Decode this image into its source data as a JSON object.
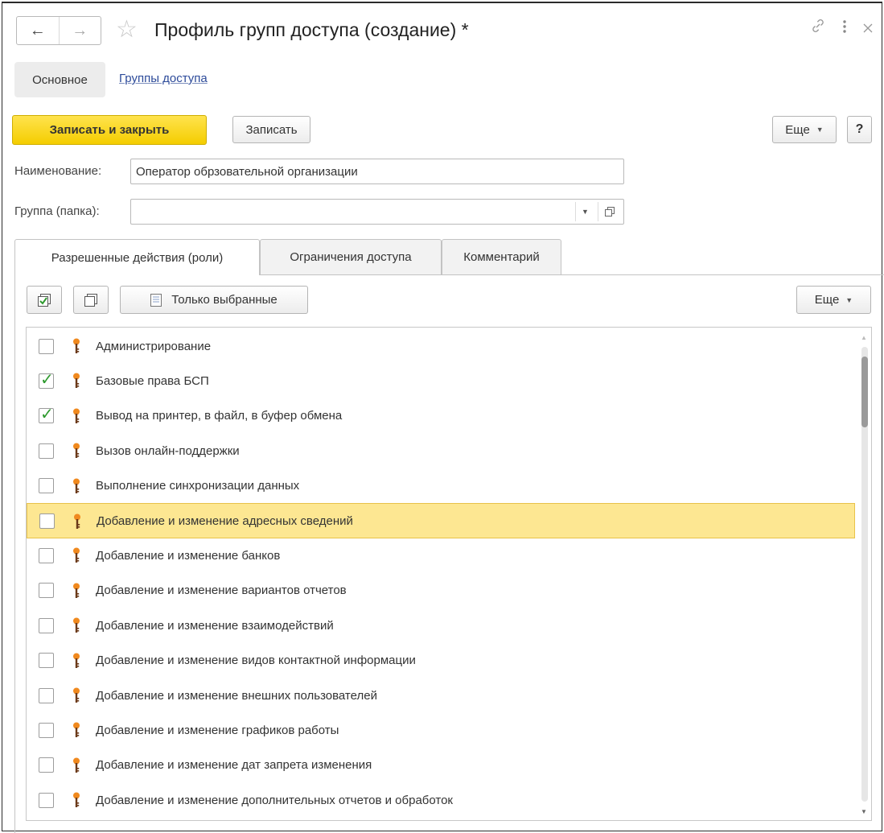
{
  "window": {
    "title": "Профиль групп доступа (создание) *",
    "back_icon": "←",
    "forward_icon": "→",
    "star_icon": "☆"
  },
  "sections": {
    "main": "Основное",
    "access_groups": "Группы доступа"
  },
  "commands": {
    "save_and_close": "Записать и закрыть",
    "save": "Записать",
    "more": "Еще",
    "help": "?"
  },
  "fields": {
    "name_label": "Наименование:",
    "name_value": "Оператор обрзовательной организации",
    "group_label": "Группа (папка):",
    "group_value": ""
  },
  "tabs": [
    {
      "label": "Разрешенные действия (роли)",
      "active": true
    },
    {
      "label": "Ограничения доступа",
      "active": false
    },
    {
      "label": "Комментарий",
      "active": false
    }
  ],
  "list_toolbar": {
    "only_selected": "Только выбранные",
    "more": "Еще"
  },
  "roles": [
    {
      "label": "Администрирование",
      "checked": false,
      "selected": false
    },
    {
      "label": "Базовые права БСП",
      "checked": true,
      "selected": false
    },
    {
      "label": "Вывод на принтер, в файл, в буфер обмена",
      "checked": true,
      "selected": false
    },
    {
      "label": "Вызов онлайн-поддержки",
      "checked": false,
      "selected": false
    },
    {
      "label": "Выполнение синхронизации данных",
      "checked": false,
      "selected": false
    },
    {
      "label": "Добавление и изменение адресных сведений",
      "checked": false,
      "selected": true
    },
    {
      "label": "Добавление и изменение банков",
      "checked": false,
      "selected": false
    },
    {
      "label": "Добавление и изменение вариантов отчетов",
      "checked": false,
      "selected": false
    },
    {
      "label": "Добавление и изменение взаимодействий",
      "checked": false,
      "selected": false
    },
    {
      "label": "Добавление и изменение видов контактной информации",
      "checked": false,
      "selected": false
    },
    {
      "label": "Добавление и изменение внешних пользователей",
      "checked": false,
      "selected": false
    },
    {
      "label": "Добавление и изменение графиков работы",
      "checked": false,
      "selected": false
    },
    {
      "label": "Добавление и изменение дат запрета изменения",
      "checked": false,
      "selected": false
    },
    {
      "label": "Добавление и изменение дополнительных отчетов и обработок",
      "checked": false,
      "selected": false
    }
  ],
  "colors": {
    "primary_button": "#f4cd00",
    "selected_row": "#fde792",
    "link": "#2d4b9a",
    "checkmark": "#2e9a2e",
    "role_key": "#f0891e"
  }
}
